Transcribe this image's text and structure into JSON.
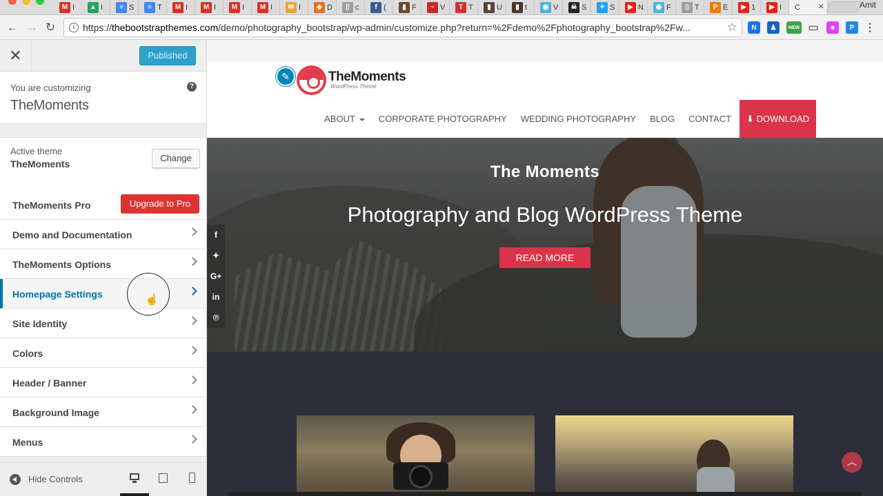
{
  "browser": {
    "profile_name": "Amit",
    "url_host": "thebootstrapthemes.com",
    "url_prefix": "https://",
    "url_path": "/demo/photography_bootstrap/wp-admin/customize.php?return=%2Fdemo%2Fphotography_bootstrap%2Fw...",
    "active_tab_text": "C",
    "tabs": [
      {
        "icon": "gmail-icon",
        "color": "#d93025",
        "glyph": "M",
        "text": "I"
      },
      {
        "icon": "drive-icon",
        "color": "#1fa463",
        "glyph": "▲",
        "text": "I"
      },
      {
        "icon": "docs-icon",
        "color": "#4285f4",
        "glyph": "≡",
        "text": "S"
      },
      {
        "icon": "docs-icon",
        "color": "#4285f4",
        "glyph": "≡",
        "text": "T"
      },
      {
        "icon": "gmail-icon",
        "color": "#d93025",
        "glyph": "M",
        "text": "I"
      },
      {
        "icon": "gmail-icon",
        "color": "#d93025",
        "glyph": "M",
        "text": "I"
      },
      {
        "icon": "gmail-icon",
        "color": "#d93025",
        "glyph": "M",
        "text": "I"
      },
      {
        "icon": "gmail-icon",
        "color": "#d93025",
        "glyph": "M",
        "text": "I"
      },
      {
        "icon": "mail-icon",
        "color": "#e8a33b",
        "glyph": "✉",
        "text": "I"
      },
      {
        "icon": "diamond-icon",
        "color": "#e8711a",
        "glyph": "◆",
        "text": "D"
      },
      {
        "icon": "page-icon",
        "color": "#9e9e9e",
        "glyph": "▯",
        "text": "c"
      },
      {
        "icon": "facebook-icon",
        "color": "#3b5998",
        "glyph": "f",
        "text": "("
      },
      {
        "icon": "person-icon",
        "color": "#6b4a2f",
        "glyph": "▮",
        "text": "F"
      },
      {
        "icon": "pulse-icon",
        "color": "#c62828",
        "glyph": "~",
        "text": "V"
      },
      {
        "icon": "t-icon",
        "color": "#d32f2f",
        "glyph": "T",
        "text": "T"
      },
      {
        "icon": "person-icon",
        "color": "#5d4037",
        "glyph": "▮",
        "text": "U"
      },
      {
        "icon": "person-icon",
        "color": "#4e342e",
        "glyph": "▮",
        "text": "t"
      },
      {
        "icon": "robot-icon",
        "color": "#4fb3d9",
        "glyph": "◉",
        "text": "V"
      },
      {
        "icon": "skull-icon",
        "color": "#222222",
        "glyph": "☠",
        "text": "S"
      },
      {
        "icon": "twitter-icon",
        "color": "#1da1f2",
        "glyph": "✦",
        "text": "S"
      },
      {
        "icon": "youtube-icon",
        "color": "#e62117",
        "glyph": "▶",
        "text": "N"
      },
      {
        "icon": "robot-icon",
        "color": "#4fb3d9",
        "glyph": "◉",
        "text": "F"
      },
      {
        "icon": "page-icon",
        "color": "#9e9e9e",
        "glyph": "▯",
        "text": "T"
      },
      {
        "icon": "p-icon",
        "color": "#f57c00",
        "glyph": "P",
        "text": "E"
      },
      {
        "icon": "youtube-icon",
        "color": "#e62117",
        "glyph": "▶",
        "text": "1"
      },
      {
        "icon": "youtube-icon",
        "color": "#e62117",
        "glyph": "▶",
        "text": "I"
      }
    ],
    "extensions": [
      {
        "icon": "extension-n-icon",
        "color": "#1a73e8",
        "glyph": "N"
      },
      {
        "icon": "extension-person-icon",
        "color": "#1565c0",
        "glyph": "♟"
      },
      {
        "icon": "extension-new-icon",
        "color": "#43a047",
        "glyph": "NEW"
      },
      {
        "icon": "cast-icon",
        "color": "#777777",
        "glyph": "▭"
      },
      {
        "icon": "extension-gradient-icon",
        "color": "#e040fb",
        "glyph": "■"
      },
      {
        "icon": "extension-p-icon",
        "color": "#1e88e5",
        "glyph": "P"
      },
      {
        "icon": "menu-dots-icon",
        "color": "#555555",
        "glyph": "⋮"
      }
    ]
  },
  "customizer": {
    "published_label": "Published",
    "customizing_label": "You are customizing",
    "customizing_name": "TheMoments",
    "active_theme_label": "Active theme",
    "active_theme_name": "TheMoments",
    "change_label": "Change",
    "pro_label": "TheMoments Pro",
    "upgrade_label": "Upgrade to Pro",
    "panels": [
      {
        "label": "Demo and Documentation"
      },
      {
        "label": "TheMoments Options"
      },
      {
        "label": "Homepage Settings"
      },
      {
        "label": "Site Identity"
      },
      {
        "label": "Colors"
      },
      {
        "label": "Header / Banner"
      },
      {
        "label": "Background Image"
      },
      {
        "label": "Menus"
      }
    ],
    "hide_controls_label": "Hide Controls"
  },
  "preview": {
    "logo_title": "TheMoments",
    "logo_subtitle": "WordPress Theme",
    "nav": [
      {
        "label": "ABOUT"
      },
      {
        "label": "CORPORATE PHOTOGRAPHY"
      },
      {
        "label": "WEDDING PHOTOGRAPHY"
      },
      {
        "label": "BLOG"
      },
      {
        "label": "CONTACT"
      }
    ],
    "download_label": "DOWNLOAD",
    "hero_title": "The Moments",
    "hero_subtitle": "Photography and Blog WordPress Theme",
    "read_more_label": "READ MORE",
    "social": [
      {
        "icon": "facebook-icon",
        "glyph": "f"
      },
      {
        "icon": "twitter-icon",
        "glyph": "✦"
      },
      {
        "icon": "google-plus-icon",
        "glyph": "G+"
      },
      {
        "icon": "linkedin-icon",
        "glyph": "in"
      },
      {
        "icon": "pinterest-icon",
        "glyph": "℗"
      }
    ]
  },
  "colors": {
    "accent_red": "#d9344a",
    "wp_blue": "#0073aa",
    "published_blue": "#2ea2cc",
    "dark_section": "#2c2f3a"
  }
}
